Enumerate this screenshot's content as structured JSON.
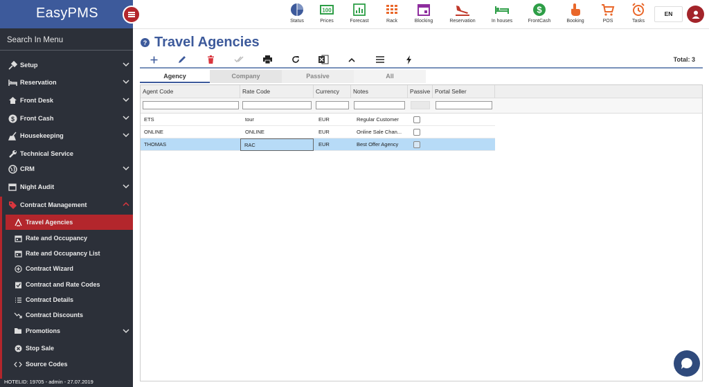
{
  "app": {
    "name": "EasyPMS"
  },
  "sidebar": {
    "search_label": "Search In Menu",
    "items": [
      {
        "label": "Setup",
        "icon": "setup-icon"
      },
      {
        "label": "Reservation",
        "icon": "bed-icon"
      },
      {
        "label": "Front Desk",
        "icon": "home-icon"
      },
      {
        "label": "Front Cash",
        "icon": "dollar-icon"
      },
      {
        "label": "Housekeeping",
        "icon": "broom-icon"
      },
      {
        "label": "Technical Service",
        "icon": "wrench-icon"
      },
      {
        "label": "CRM",
        "icon": "globe-icon"
      },
      {
        "label": "Night Audit",
        "icon": "calendar-icon"
      },
      {
        "label": "Contract Management",
        "icon": "tag-icon"
      }
    ],
    "subitems": [
      {
        "label": "Travel Agencies"
      },
      {
        "label": "Rate and Occupancy"
      },
      {
        "label": "Rate and Occupancy List"
      },
      {
        "label": "Contract Wizard"
      },
      {
        "label": "Contract and Rate Codes"
      },
      {
        "label": "Contract Details"
      },
      {
        "label": "Contract Discounts"
      },
      {
        "label": "Promotions"
      },
      {
        "label": "Stop Sale"
      },
      {
        "label": "Source Codes"
      }
    ],
    "footer": "HOTELID: 19705 - admin - 27.07.2019"
  },
  "topbar": {
    "items": [
      {
        "label": "Status",
        "color": "#3d5a9b"
      },
      {
        "label": "Prices",
        "color": "#2e9e47"
      },
      {
        "label": "Forecast",
        "color": "#2e9e47"
      },
      {
        "label": "Rack",
        "color": "#e9672a"
      },
      {
        "label": "Blocking",
        "color": "#8e2d9e"
      },
      {
        "label": "Reservation",
        "color": "#c0392b"
      },
      {
        "label": "In houses",
        "color": "#2e9e47"
      },
      {
        "label": "FrontCash",
        "color": "#2e9e47"
      },
      {
        "label": "Booking",
        "color": "#e9672a"
      },
      {
        "label": "POS",
        "color": "#e9672a"
      },
      {
        "label": "Tasks",
        "color": "#e9672a"
      }
    ],
    "language": "EN"
  },
  "page": {
    "help": "?",
    "title": "Travel Agencies",
    "total": "Total: 3"
  },
  "tabs": [
    "Agency",
    "Company",
    "Passive",
    "All"
  ],
  "grid": {
    "columns": [
      "Agent Code",
      "Rate Code",
      "Currency",
      "Notes",
      "Passive",
      "Portal Seller"
    ],
    "rows": [
      {
        "agent": "ETS",
        "rate": "tour",
        "currency": "EUR",
        "notes": "Regular Customer",
        "passive": false
      },
      {
        "agent": "ONLINE",
        "rate": "ONLINE",
        "currency": "EUR",
        "notes": "Online Sale Chan...",
        "passive": false
      },
      {
        "agent": "THOMAS",
        "rate": "RAC",
        "currency": "EUR",
        "notes": "Best Offer Agency",
        "passive": false
      }
    ]
  },
  "colors": {
    "primary": "#3d5a9b",
    "accent": "#b3262c",
    "sidebar": "#2c3039",
    "selected_row": "#b7dbf7"
  }
}
